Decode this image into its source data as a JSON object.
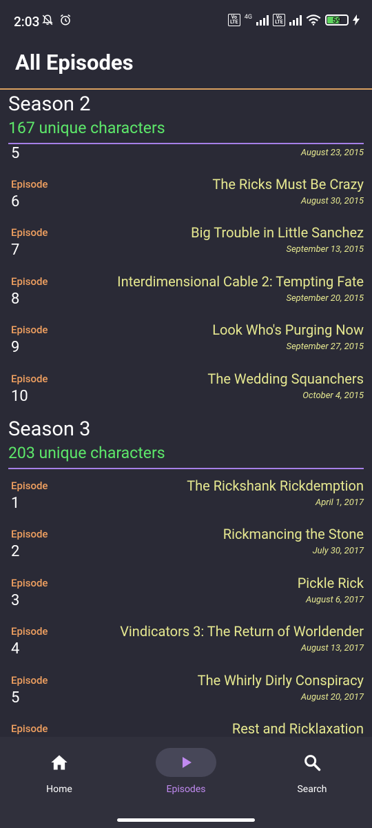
{
  "status_bar": {
    "time": "2:03",
    "network": "4G",
    "volte1": "Vo LTE",
    "volte2": "Vo LTE",
    "battery": "59"
  },
  "header": {
    "title": "All Episodes"
  },
  "episode_label": "Episode",
  "seasons": [
    {
      "title": "Season 2",
      "count": "167 unique characters",
      "episodes": [
        {
          "number": "5",
          "title": "",
          "date": "August 23, 2015"
        },
        {
          "number": "6",
          "title": "The Ricks Must Be Crazy",
          "date": "August 30, 2015"
        },
        {
          "number": "7",
          "title": "Big Trouble in Little Sanchez",
          "date": "September 13, 2015"
        },
        {
          "number": "8",
          "title": "Interdimensional Cable 2: Tempting Fate",
          "date": "September 20, 2015"
        },
        {
          "number": "9",
          "title": "Look Who's Purging Now",
          "date": "September 27, 2015"
        },
        {
          "number": "10",
          "title": "The Wedding Squanchers",
          "date": "October 4, 2015"
        }
      ]
    },
    {
      "title": "Season 3",
      "count": "203 unique characters",
      "episodes": [
        {
          "number": "1",
          "title": "The Rickshank Rickdemption",
          "date": "April 1, 2017"
        },
        {
          "number": "2",
          "title": "Rickmancing the Stone",
          "date": "July 30, 2017"
        },
        {
          "number": "3",
          "title": "Pickle Rick",
          "date": "August 6, 2017"
        },
        {
          "number": "4",
          "title": "Vindicators 3: The Return of Worldender",
          "date": "August 13, 2017"
        },
        {
          "number": "5",
          "title": "The Whirly Dirly Conspiracy",
          "date": "August 20, 2017"
        },
        {
          "number": "",
          "title": "Rest and Ricklaxation",
          "date": ""
        }
      ]
    }
  ],
  "nav": {
    "home": "Home",
    "episodes": "Episodes",
    "search": "Search"
  },
  "colors": {
    "background": "#2a2a36",
    "season_count": "#5de86a",
    "episode_label": "#f0a060",
    "episode_title": "#e6e890",
    "accent": "#c08af0",
    "divider_title": "#d9a060",
    "divider_season": "#a680e8"
  },
  "icons": {
    "home": "home-icon",
    "episodes": "play-icon",
    "search": "search-icon"
  }
}
